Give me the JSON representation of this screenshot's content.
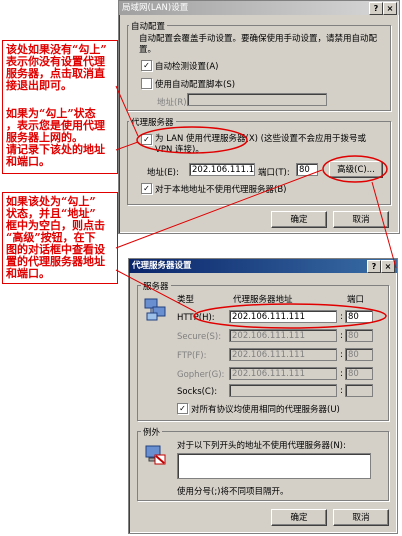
{
  "lan_dialog": {
    "title": "局域网(LAN)设置",
    "help": "?",
    "close": "×",
    "auto_group": "自动配置",
    "auto_desc": "自动配置会覆盖手动设置。要确保使用手动设置，请禁用自动配置。",
    "auto_detect": "自动检测设置(A)",
    "use_script": "使用自动配置脚本(S)",
    "address": "地址(R)",
    "proxy_group": "代理服务器",
    "use_proxy_1": "为 LAN 使用代理服务器(X) (这些设置不会应用于拨号或",
    "use_proxy_2": "VPN 连接)。",
    "addr_label": "地址(E):",
    "addr_value": "202.106.111.1",
    "port_label": "端口(T):",
    "port_value": "80",
    "advanced": "高级(C)...",
    "bypass_local": "对于本地地址不使用代理服务器(B)",
    "ok": "确定",
    "cancel": "取消"
  },
  "proxy_dialog": {
    "title": "代理服务器设置",
    "help": "?",
    "close": "×",
    "servers_group": "服务器",
    "col_type": "类型",
    "col_addr": "代理服务器地址",
    "col_port": "端口",
    "rows": [
      {
        "type": "HTTP(H):",
        "addr": "202.106.111.111",
        "port": "80",
        "enabled": true
      },
      {
        "type": "Secure(S):",
        "addr": "202.106.111.111",
        "port": "80",
        "enabled": false
      },
      {
        "type": "FTP(F):",
        "addr": "202.106.111.111",
        "port": "80",
        "enabled": false
      },
      {
        "type": "Gopher(G):",
        "addr": "202.106.111.111",
        "port": "80",
        "enabled": false
      },
      {
        "type": "Socks(C):",
        "addr": "",
        "port": "",
        "enabled": false
      }
    ],
    "same_for_all": "对所有协议均使用相同的代理服务器(U)",
    "exceptions_group": "例外",
    "exceptions_desc": "对于以下列开头的地址不使用代理服务器(N):",
    "exceptions_hint": "使用分号(;)将不同项目隔开。",
    "ok": "确定",
    "cancel": "取消"
  },
  "notes": {
    "note1": [
      "该处如果没有“勾上”",
      "表示你没有设置代理",
      "服务器，点击取消直",
      "接退出即可。"
    ],
    "note2": [
      "如果为“勾上”状态",
      "，表示您是使用代理",
      "服务器上网的。",
      "请记录下该处的地址",
      "和端口。"
    ],
    "note3": [
      "如果该处为“勾上”",
      "状态，并且“地址”",
      "框中为空白，则点击",
      "“高级”按钮，在下",
      "图的对话框中查看设",
      "置的代理服务器地址",
      "和端口。"
    ]
  },
  "colors": {
    "annotation": "#e00000",
    "titlebar_active": "#0a246a"
  }
}
